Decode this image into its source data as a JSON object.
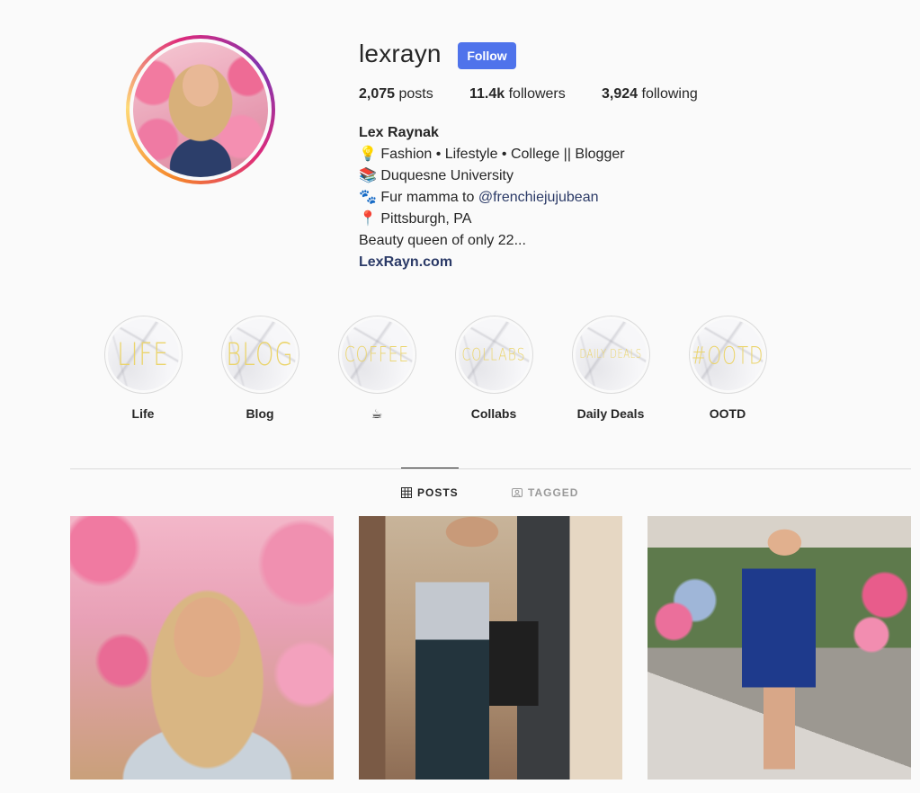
{
  "profile": {
    "username": "lexrayn",
    "follow_label": "Follow",
    "stats": {
      "posts_count": "2,075",
      "posts_label": "posts",
      "followers_count": "11.4k",
      "followers_label": "followers",
      "following_count": "3,924",
      "following_label": "following"
    },
    "bio": {
      "name": "Lex Raynak",
      "line1": "💡 Fashion • Lifestyle • College || Blogger",
      "line2": "📚 Duquesne University",
      "line3_prefix": "🐾 Fur mamma to ",
      "line3_mention": "@frenchiejujubean",
      "line4": "📍 Pittsburgh, PA",
      "line5": "Beauty queen of only 22...",
      "website": "LexRayn.com"
    }
  },
  "highlights": [
    {
      "cover_text": "LIFE",
      "label": "Life"
    },
    {
      "cover_text": "BLOG",
      "label": "Blog"
    },
    {
      "cover_text": "COFFEE",
      "label": "☕"
    },
    {
      "cover_text": "COLLABS",
      "label": "Collabs"
    },
    {
      "cover_text": "DAILY DEALS",
      "label": "Daily Deals"
    },
    {
      "cover_text": "#OOTD",
      "label": "OOTD"
    }
  ],
  "tabs": {
    "posts": {
      "label": "POSTS",
      "icon": "grid-icon"
    },
    "tagged": {
      "label": "TAGGED",
      "icon": "tag-person-icon"
    }
  },
  "colors": {
    "accent_button": "#4f73eb",
    "highlight_text": "#ebd46a",
    "link": "#2b3a67"
  }
}
